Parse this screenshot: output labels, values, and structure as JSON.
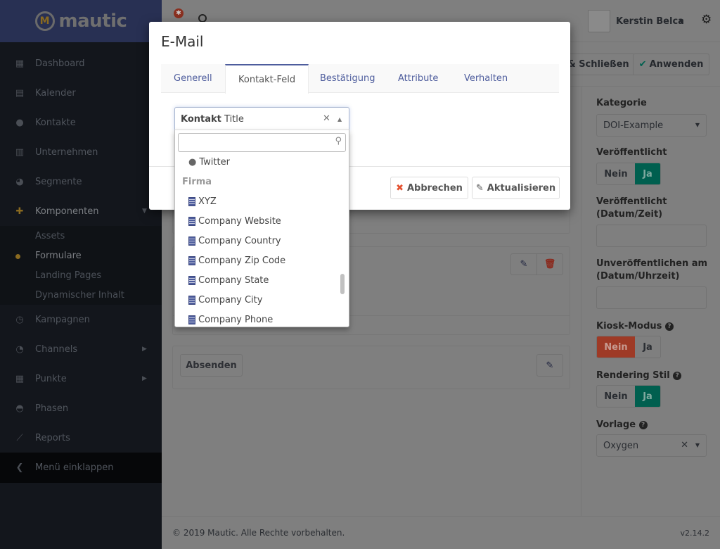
{
  "brand": {
    "name": "mautic",
    "logo_letter": "M"
  },
  "sidebar": {
    "items": [
      {
        "label": "Dashboard",
        "icon": "grid-icon"
      },
      {
        "label": "Kalender",
        "icon": "calendar-icon"
      },
      {
        "label": "Kontakte",
        "icon": "user-icon"
      },
      {
        "label": "Unternehmen",
        "icon": "building-icon"
      },
      {
        "label": "Segmente",
        "icon": "pie-chart-icon"
      },
      {
        "label": "Komponenten",
        "icon": "puzzle-icon"
      },
      {
        "label": "Kampagnen",
        "icon": "clock-icon"
      },
      {
        "label": "Channels",
        "icon": "rss-icon"
      },
      {
        "label": "Punkte",
        "icon": "calculator-icon"
      },
      {
        "label": "Phasen",
        "icon": "dashboard-gauge-icon"
      },
      {
        "label": "Reports",
        "icon": "line-chart-icon"
      }
    ],
    "sub_items": [
      "Assets",
      "Formulare",
      "Landing Pages",
      "Dynamischer Inhalt"
    ],
    "active_sub": "Formulare",
    "collapse_label": "Menü einklappen"
  },
  "topbar": {
    "user_name": "Kerstin Belca"
  },
  "toolbar": {
    "save_close": "& Schließen",
    "apply": "Anwenden"
  },
  "form": {
    "submit_label": "Absenden"
  },
  "right_panel": {
    "category_label": "Kategorie",
    "category_value": "DOI-Example",
    "published_label": "Veröffentlicht",
    "published_value": "Ja",
    "publish_up_label": "Veröffentlicht (Datum/Zeit)",
    "publish_down_label": "Unveröffentlichen am (Datum/Uhrzeit)",
    "kiosk_label": "Kiosk-Modus",
    "kiosk_value": "Nein",
    "render_label": "Rendering Stil",
    "render_value": "Ja",
    "template_label": "Vorlage",
    "template_value": "Oxygen",
    "no": "Nein",
    "yes": "Ja"
  },
  "footer": {
    "copyright": "© 2019 Mautic. Alle Rechte vorbehalten.",
    "version": "v2.14.2"
  },
  "modal": {
    "title": "E-Mail",
    "tabs": [
      "Generell",
      "Kontakt-Feld",
      "Bestätigung",
      "Attribute",
      "Verhalten"
    ],
    "active_tab": "Kontakt-Feld",
    "select": {
      "group": "Kontakt",
      "value": "Title",
      "search_placeholder": ""
    },
    "options": [
      {
        "label": "Twitter",
        "icon": "user-icon"
      }
    ],
    "group_label": "Firma",
    "group_options": [
      "XYZ",
      "Company Website",
      "Company Country",
      "Company Zip Code",
      "Company State",
      "Company City",
      "Company Phone"
    ],
    "cancel": "Abbrechen",
    "update": "Aktualisieren"
  },
  "colors": {
    "brand": "#4e5d9d",
    "danger": "#c0392b",
    "success": "#00b49c",
    "accent": "#fdb933"
  }
}
